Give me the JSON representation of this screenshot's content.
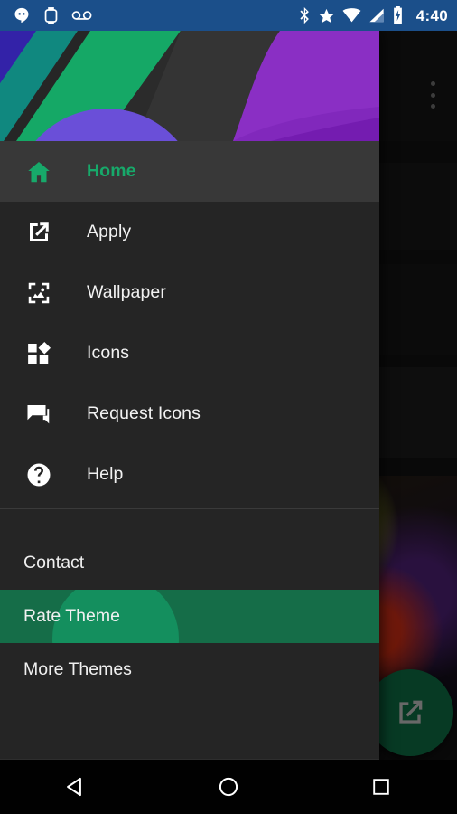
{
  "statusbar": {
    "time": "4:40",
    "left_icons": [
      "hangouts-icon",
      "smartwatch-icon",
      "voicemail-icon"
    ],
    "right_icons": [
      "bluetooth-icon",
      "star-priority-icon",
      "wifi-icon",
      "cell-signal-icon",
      "battery-charging-icon"
    ],
    "background_color": "#1b4f8a"
  },
  "drawer": {
    "header_name": "drawer-header-banner",
    "accent_color": "#17a96a",
    "background_color": "#252525",
    "active_background_color": "#383838",
    "items": [
      {
        "label": "Home",
        "icon": "home-icon",
        "active": true
      },
      {
        "label": "Apply",
        "icon": "open-in-new-icon",
        "active": false
      },
      {
        "label": "Wallpaper",
        "icon": "photo-frame-icon",
        "active": false
      },
      {
        "label": "Icons",
        "icon": "icons-grid-icon",
        "active": false
      },
      {
        "label": "Request Icons",
        "icon": "forum-icon",
        "active": false
      },
      {
        "label": "Help",
        "icon": "help-circle-icon",
        "active": false
      }
    ],
    "sub_items": [
      {
        "label": "Contact",
        "pressed": false
      },
      {
        "label": "Rate Theme",
        "pressed": true
      },
      {
        "label": "More Themes",
        "pressed": false
      }
    ],
    "ripple_color": "#148f5e",
    "pressed_color": "#156d48"
  },
  "behind": {
    "overflow_menu": "overflow-menu-icon",
    "fab": {
      "name": "fab-open-in-new",
      "icon": "open-in-new-icon",
      "color": "#0e6b42"
    },
    "cards": [
      "play-store-card",
      "purple-circle-card",
      "dark-card",
      "photo-card"
    ]
  },
  "navbar": {
    "back": "back-icon",
    "home": "home-circle-icon",
    "recents": "recents-square-icon"
  }
}
